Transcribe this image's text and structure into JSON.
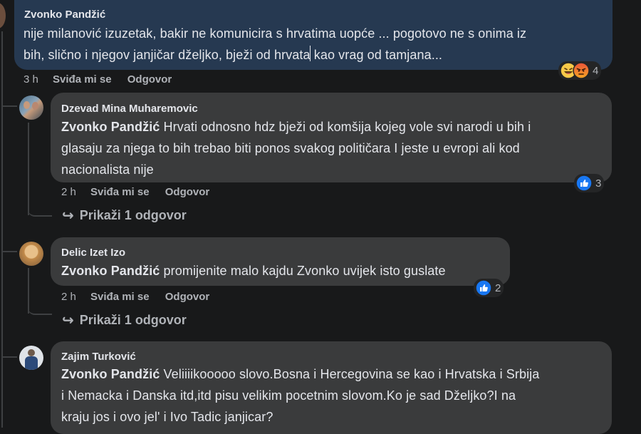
{
  "main_comment": {
    "author": "Zvonko Pandžić",
    "line1": "nije milanović izuzetak, bakir ne komunicira s hrvatima uopće ... pogotovo ne s onima iz",
    "line2a": "bih, slično i njegov janjičar dželjko, bježi od ",
    "line2b": "hrvata kao vrag od tamjana...",
    "time": "3 h",
    "like": "Sviđa mi se",
    "reply": "Odgovor",
    "reaction_count": "4",
    "reaction_icons": [
      "laughing-emoji",
      "angry-emoji"
    ]
  },
  "replies": [
    {
      "author": "Dzevad Mina Muharemovic",
      "tag": "Zvonko Pandžić",
      "line1": "Hrvati odnosno hdz bježi od komšija kojeg vole svi narodi u bih i",
      "line2": "glasaju za njega to bih trebao biti ponos svakog političara I jeste u evropi ali kod",
      "line3": "nacionalista nije",
      "time": "2 h",
      "like": "Sviđa mi se",
      "reply": "Odgovor",
      "reaction_count": "3",
      "view_replies": "Prikaži 1 odgovor"
    },
    {
      "author": "Delic Izet Izo",
      "tag": "Zvonko Pandžić",
      "line1": "promijenite malo kajdu Zvonko uvijek isto guslate",
      "time": "2 h",
      "like": "Sviđa mi se",
      "reply": "Odgovor",
      "reaction_count": "2",
      "view_replies": "Prikaži 1 odgovor"
    },
    {
      "author": "Zajim Turković",
      "tag": "Zvonko Pandžić",
      "line1": "Veliiiikooooo slovo.Bosna i Hercegovina se kao i Hrvatska i Srbija",
      "line2": "i Nemacka i Danska itd,itd pisu velikim pocetnim slovom.Ko je sad Dželjko?I na",
      "line3": "kraju jos i ovo jel' i Ivo Tadic janjicar?"
    }
  ],
  "colors": {
    "background": "#18191a",
    "highlight_bubble": "#263951",
    "bubble": "#3a3b3c",
    "like_blue": "#1877f2"
  }
}
